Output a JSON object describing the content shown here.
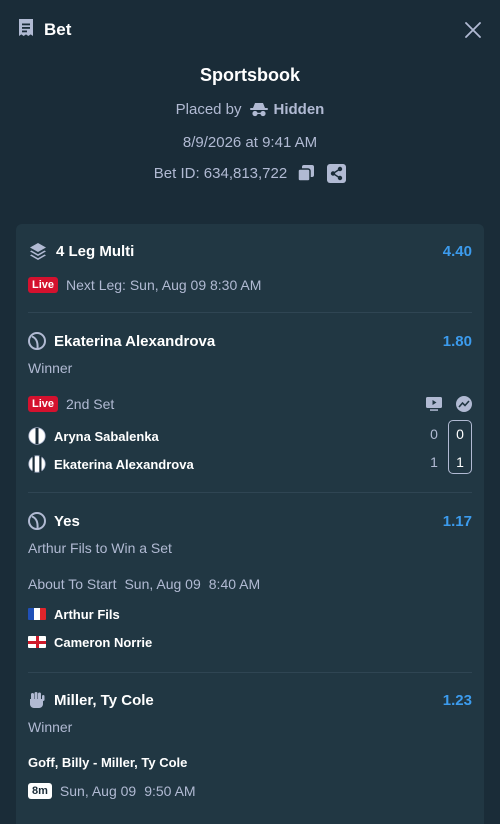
{
  "header": {
    "title": "Bet"
  },
  "info": {
    "title": "Sportsbook",
    "placed_by_label": "Placed by",
    "placed_by_user": "Hidden",
    "date": "8/9/2026 at 9:41 AM",
    "bet_id": "Bet ID: 634,813,722"
  },
  "multi": {
    "title": "4 Leg Multi",
    "odds": "4.40",
    "live_label": "Live",
    "next_leg": "Next Leg: Sun, Aug 09 8:30 AM"
  },
  "legs": [
    {
      "title": "Ekaterina Alexandrova",
      "odds": "1.80",
      "market": "Winner",
      "status_label": "Live",
      "status_text": "2nd Set",
      "players": [
        {
          "name": "Aryna Sabalenka",
          "games": "0",
          "sets": "0"
        },
        {
          "name": "Ekaterina Alexandrova",
          "games": "1",
          "sets": "1"
        }
      ]
    },
    {
      "title": "Yes",
      "odds": "1.17",
      "market": "Arthur Fils to Win a Set",
      "status_text": "About To Start",
      "date": "Sun, Aug 09",
      "time": "8:40 AM",
      "players": [
        {
          "name": "Arthur Fils",
          "flag": "france"
        },
        {
          "name": "Cameron Norrie",
          "flag": "england"
        }
      ]
    },
    {
      "title": "Miller, Ty Cole",
      "odds": "1.23",
      "market": "Winner",
      "matchup": "Goff, Billy - Miller, Ty Cole",
      "countdown": "8m",
      "date": "Sun, Aug 09",
      "time": "9:50 AM"
    }
  ],
  "colors": {
    "background": "#1a2c38",
    "card": "#213743",
    "accent": "#3c9bed",
    "live": "#d4112e",
    "text_secondary": "#b1bad3"
  },
  "icons": [
    "receipt-icon",
    "close-icon",
    "incognito-icon",
    "copy-icon",
    "share-icon",
    "layers-icon",
    "tennis-ball-icon",
    "livestream-icon",
    "stats-icon",
    "fist-icon"
  ]
}
